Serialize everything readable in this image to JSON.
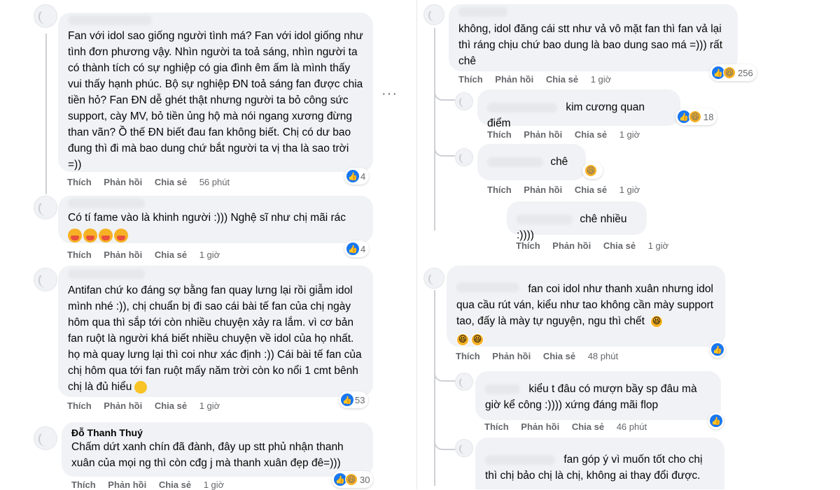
{
  "actions": {
    "like": "Thích",
    "reply": "Phản hồi",
    "share": "Chia sẻ"
  },
  "left_comments": [
    {
      "text": "Fan với idol sao giống người tình má? Fan với idol giống như tình đơn phương vậy. Nhìn người ta toả sáng, nhìn người ta có thành tích có sự nghiệp có gia đình êm ấm là mình thấy vui thấy hạnh phúc. Bộ sự nghiệp ĐN toả sáng fan được chia tiền hỏ? Fan ĐN dễ ghét thật nhưng người ta bỏ công sức support, cày MV, bỏ tiền ủng hộ mà nói ngang xương đừng than vãn? Ồ thế ĐN biết đau fan không biết. Chị có dư bao đung thì đi mà bao dung chứ bắt người ta vị tha là sao trời =))",
      "reactions": "4",
      "time": "56 phút"
    },
    {
      "text": "Có tí fame vào là khinh người :))) Nghệ sĩ như chị mãi rác",
      "reactions": "4",
      "time": "1 giờ"
    },
    {
      "text": "Antifan chứ ko đáng sợ bằng fan quay lưng lại rồi giẫm idol mình nhé :)), chị chuẩn bị đi sao cái bài tế fan của chị ngày hôm qua thì sắp tới còn nhiều chuyện xảy ra lắm. vì cơ bản fan ruột là người khá biết nhiều chuyện về idol của họ nhất. họ mà quay lưng lại thì coi như xác định :)) Cái bài tế fan của chị hôm qua tới fan ruột mấy năm trời còn ko nổi 1 cmt bênh chị là đủ hiểu",
      "reactions": "53",
      "time": "1 giờ"
    },
    {
      "author": "Đỗ Thanh Thuý",
      "text": "Chấm dứt xanh chín đã đành, đây up stt phủ nhận thanh xuân của mọi ng thì còn cđg j mà thanh xuân đẹp đê=)))",
      "reactions": "30",
      "time": "1 giờ"
    }
  ],
  "right_comments": [
    {
      "text": "không, idol đăng cái stt như vả vô mặt fan thì fan vả lại thì ráng chịu chứ bao dung là bao dung sao má =))) rất chê",
      "reactions": "256",
      "time": "1 giờ"
    },
    {
      "text": "kim cương quan điểm",
      "reactions": "18",
      "time": "1 giờ"
    },
    {
      "text": "chê",
      "time": "1 giờ"
    },
    {
      "text": "chê nhiều :))))",
      "time": "1 giờ"
    },
    {
      "text": "fan coi idol như thanh xuân nhưng idol qua cầu rút ván, kiểu như tao không cần mày support tao, đấy là mày tự nguyện, ngu thì chết",
      "time": "48 phút"
    },
    {
      "text": "kiểu t đâu có mượn bầy sp đâu mà giờ kể công :)))) xứng đáng mãi flop",
      "time": "46 phút"
    },
    {
      "text": "fan góp ý vì muốn tốt cho chị thì chị bảo chị là chị, không ai thay đổi được."
    }
  ],
  "colors": {
    "bubble": "#f0f2f5",
    "meta": "#65676b",
    "like": "#1877f2",
    "haha": "#f7b125"
  }
}
